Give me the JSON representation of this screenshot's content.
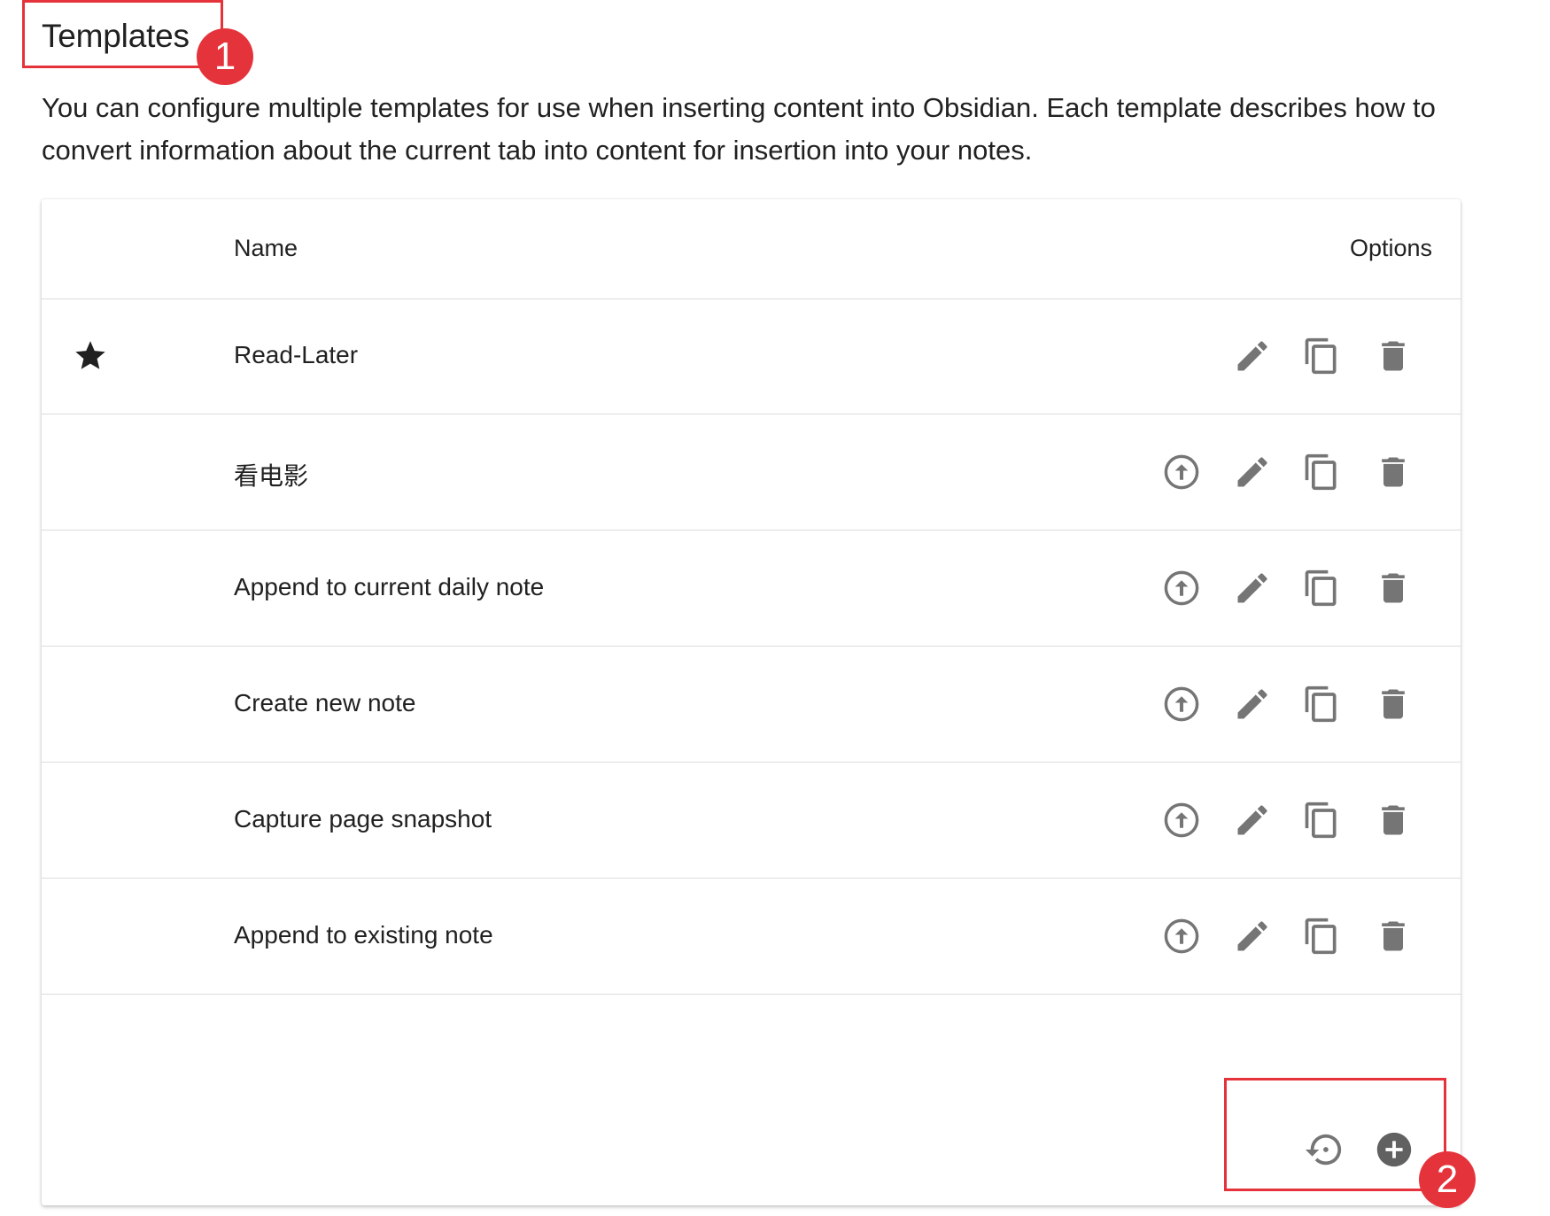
{
  "section": {
    "title": "Templates",
    "description": "You can configure multiple templates for use when inserting content into Obsidian. Each template describes how to convert information about the current tab into content for insertion into your notes."
  },
  "annotations": [
    "1",
    "2"
  ],
  "table": {
    "columns": {
      "name": "Name",
      "options": "Options"
    },
    "rows": [
      {
        "name": "Read-Later",
        "default": true
      },
      {
        "name": "看电影",
        "default": false
      },
      {
        "name": "Append to current daily note",
        "default": false
      },
      {
        "name": "Create new note",
        "default": false
      },
      {
        "name": "Capture page snapshot",
        "default": false
      },
      {
        "name": "Append to existing note",
        "default": false
      }
    ],
    "row_icons": [
      "star-icon",
      "arrow-up-circle-icon",
      "edit-pencil-icon",
      "copy-icon",
      "delete-trash-icon"
    ],
    "footer_icons": [
      "restore-icon",
      "add-circle-icon"
    ]
  },
  "colors": {
    "annotation": "#e5333b",
    "icon": "#757575",
    "text": "#212121",
    "divider": "#dcdcdc"
  }
}
